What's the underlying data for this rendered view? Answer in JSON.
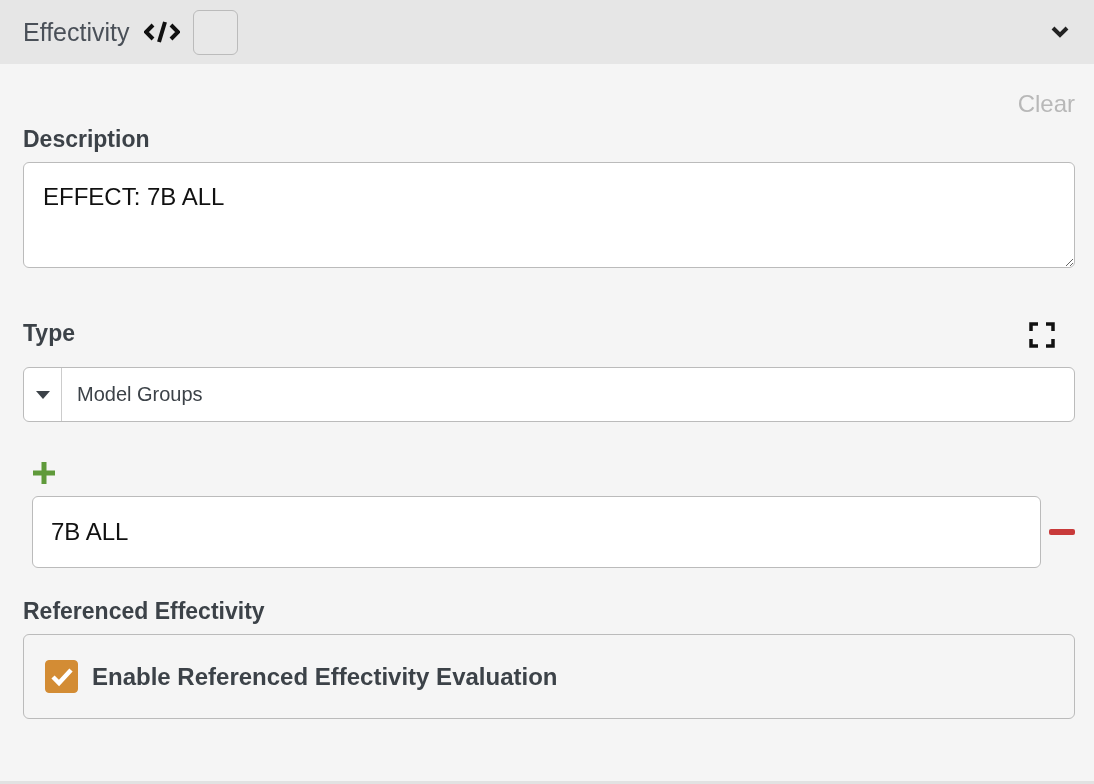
{
  "header": {
    "title": "Effectivity",
    "checked": false
  },
  "clear_label": "Clear",
  "description": {
    "label": "Description",
    "value": "EFFECT: 7B ALL"
  },
  "type": {
    "label": "Type",
    "value": "Model Groups"
  },
  "values": [
    {
      "value": "7B ALL"
    }
  ],
  "referenced": {
    "label": "Referenced Effectivity",
    "option": {
      "label": "Enable Referenced Effectivity Evaluation",
      "checked": true
    }
  }
}
